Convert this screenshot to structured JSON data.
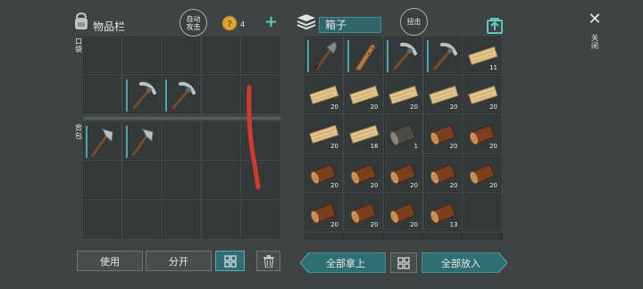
{
  "inventory": {
    "title": "物品栏",
    "auto_attack_line1": "自动",
    "auto_attack_line2": "攻击",
    "coin_count": "4",
    "plus_symbol": "+",
    "side_label_top": "口袋",
    "side_label_bottom": "背包",
    "use_button": "使用",
    "split_button": "分开"
  },
  "chest": {
    "title": "箱子",
    "steal_button": "扭击",
    "take_all_button": "全部拿上",
    "put_all_button": "全部放入"
  },
  "close": {
    "symbol": "✕",
    "label": "关闭"
  },
  "pockets": [
    {
      "item": "",
      "qty": ""
    },
    {
      "item": "",
      "qty": ""
    },
    {
      "item": "",
      "qty": ""
    },
    {
      "item": "",
      "qty": ""
    },
    {
      "item": "",
      "qty": ""
    },
    {
      "item": "",
      "qty": ""
    },
    {
      "item": "pickaxe",
      "qty": ""
    },
    {
      "item": "pickaxe",
      "qty": ""
    },
    {
      "item": "",
      "qty": ""
    },
    {
      "item": "",
      "qty": ""
    }
  ],
  "backpack": [
    {
      "item": "hatchet",
      "qty": ""
    },
    {
      "item": "hatchet",
      "qty": ""
    },
    {
      "item": "",
      "qty": ""
    },
    {
      "item": "",
      "qty": ""
    },
    {
      "item": "",
      "qty": ""
    },
    {
      "item": "",
      "qty": ""
    },
    {
      "item": "",
      "qty": ""
    },
    {
      "item": "",
      "qty": ""
    },
    {
      "item": "",
      "qty": ""
    },
    {
      "item": "",
      "qty": ""
    },
    {
      "item": "",
      "qty": ""
    },
    {
      "item": "",
      "qty": ""
    },
    {
      "item": "",
      "qty": ""
    },
    {
      "item": "",
      "qty": ""
    },
    {
      "item": "",
      "qty": ""
    }
  ],
  "chest_slots": [
    {
      "item": "shovel",
      "qty": ""
    },
    {
      "item": "club",
      "qty": ""
    },
    {
      "item": "pickaxe",
      "qty": ""
    },
    {
      "item": "pickaxe",
      "qty": ""
    },
    {
      "item": "plank",
      "qty": "11"
    },
    {
      "item": "plank",
      "qty": "20"
    },
    {
      "item": "plank",
      "qty": "20"
    },
    {
      "item": "plank",
      "qty": "20"
    },
    {
      "item": "plank",
      "qty": "20"
    },
    {
      "item": "plank",
      "qty": "20"
    },
    {
      "item": "plank",
      "qty": "20"
    },
    {
      "item": "plank",
      "qty": "16"
    },
    {
      "item": "stone-log",
      "qty": "1"
    },
    {
      "item": "log",
      "qty": "20"
    },
    {
      "item": "log",
      "qty": "20"
    },
    {
      "item": "log",
      "qty": "20"
    },
    {
      "item": "log",
      "qty": "20"
    },
    {
      "item": "log",
      "qty": "20"
    },
    {
      "item": "log",
      "qty": "20"
    },
    {
      "item": "log",
      "qty": "20"
    },
    {
      "item": "log",
      "qty": "20"
    },
    {
      "item": "log",
      "qty": "20"
    },
    {
      "item": "log",
      "qty": "20"
    },
    {
      "item": "log",
      "qty": "13"
    },
    {
      "item": "",
      "qty": ""
    }
  ]
}
